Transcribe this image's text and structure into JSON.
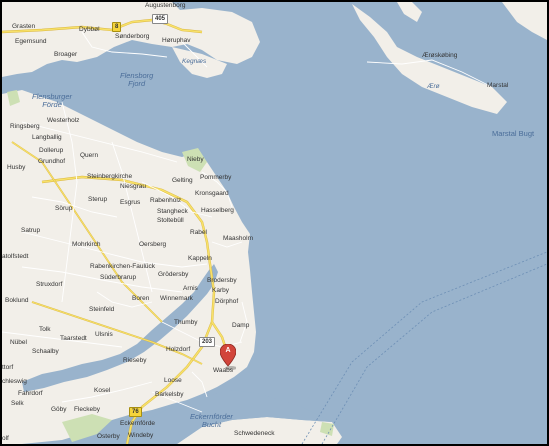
{
  "map": {
    "marker": {
      "label": "A",
      "color": "#d2453b"
    },
    "places": [
      {
        "id": "augustenborg",
        "text": "Augustenborg"
      },
      {
        "id": "grasten",
        "text": "Grasten"
      },
      {
        "id": "egernsund",
        "text": "Egernsund"
      },
      {
        "id": "dybbol",
        "text": "Dybbøl"
      },
      {
        "id": "sonderborg",
        "text": "Sønderborg"
      },
      {
        "id": "horuphav",
        "text": "Høruphav"
      },
      {
        "id": "broager",
        "text": "Broager"
      },
      {
        "id": "flensborg-fjord",
        "text": "Flensborg\nFjord",
        "kind": "water"
      },
      {
        "id": "kegnaes",
        "text": "Kegnæs",
        "kind": "island"
      },
      {
        "id": "aeroskobing",
        "text": "Ærøskøbing"
      },
      {
        "id": "aero",
        "text": "Ærø",
        "kind": "island"
      },
      {
        "id": "marstal",
        "text": "Marstal"
      },
      {
        "id": "marstal-bugt",
        "text": "Marstal Bugt",
        "kind": "water-lg"
      },
      {
        "id": "flensburger-forde",
        "text": "Flensburger\nFörde",
        "kind": "water"
      },
      {
        "id": "westerholz",
        "text": "Westerholz"
      },
      {
        "id": "ringsberg",
        "text": "Ringsberg"
      },
      {
        "id": "langballig",
        "text": "Langballig"
      },
      {
        "id": "dollerup",
        "text": "Dollerup"
      },
      {
        "id": "grundhof",
        "text": "Grundhof"
      },
      {
        "id": "husby",
        "text": "Husby"
      },
      {
        "id": "quern",
        "text": "Quern"
      },
      {
        "id": "nieby",
        "text": "Nieby"
      },
      {
        "id": "steinbergkirche",
        "text": "Steinbergkirche"
      },
      {
        "id": "gelting",
        "text": "Gelting"
      },
      {
        "id": "pommerby",
        "text": "Pommerby"
      },
      {
        "id": "niesgrau",
        "text": "Niesgrau"
      },
      {
        "id": "kronsgaard",
        "text": "Kronsgaard"
      },
      {
        "id": "sterup",
        "text": "Sterup"
      },
      {
        "id": "esgrus",
        "text": "Esgrus"
      },
      {
        "id": "rabenholz",
        "text": "Rabenholz"
      },
      {
        "id": "sorup",
        "text": "Sörup"
      },
      {
        "id": "stangheck",
        "text": "Stangheck"
      },
      {
        "id": "hasselberg",
        "text": "Hasselberg"
      },
      {
        "id": "stoltebull",
        "text": "Stoltebüll"
      },
      {
        "id": "satrup",
        "text": "Satrup"
      },
      {
        "id": "rabel",
        "text": "Rabel"
      },
      {
        "id": "maasholm",
        "text": "Maasholm"
      },
      {
        "id": "mohrkirch",
        "text": "Mohrkirch"
      },
      {
        "id": "oersberg",
        "text": "Oersberg"
      },
      {
        "id": "tolfstedt",
        "text": "atolfstedt"
      },
      {
        "id": "kappeln",
        "text": "Kappeln"
      },
      {
        "id": "rabenkirchen",
        "text": "Rabenkirchen-Faulück"
      },
      {
        "id": "suderbrarup",
        "text": "Süderbrarup"
      },
      {
        "id": "grodersby",
        "text": "Grödersby"
      },
      {
        "id": "brodersby",
        "text": "Brodersby"
      },
      {
        "id": "struxdorf",
        "text": "Struxdorf"
      },
      {
        "id": "arnis",
        "text": "Arnis"
      },
      {
        "id": "karby",
        "text": "Karby"
      },
      {
        "id": "boren",
        "text": "Boren"
      },
      {
        "id": "winnemark",
        "text": "Winnemark"
      },
      {
        "id": "dorphof",
        "text": "Dörphof"
      },
      {
        "id": "boklund",
        "text": "Boklund"
      },
      {
        "id": "steinfeld",
        "text": "Steinfeld"
      },
      {
        "id": "thumby",
        "text": "Thumby"
      },
      {
        "id": "damp",
        "text": "Damp"
      },
      {
        "id": "tolk",
        "text": "Tolk"
      },
      {
        "id": "taarstedt",
        "text": "Taarstedt"
      },
      {
        "id": "ulsnis",
        "text": "Ulsnis"
      },
      {
        "id": "nubel",
        "text": "Nübel"
      },
      {
        "id": "schaalby",
        "text": "Schaalby"
      },
      {
        "id": "holzdorf",
        "text": "Holzdorf"
      },
      {
        "id": "rieseby",
        "text": "Rieseby"
      },
      {
        "id": "waabs",
        "text": "Waabs"
      },
      {
        "id": "schleswig",
        "text": "chleswig"
      },
      {
        "id": "fahrdorf",
        "text": "Fahrdorf"
      },
      {
        "id": "kosel",
        "text": "Kosel"
      },
      {
        "id": "loose",
        "text": "Loose"
      },
      {
        "id": "barkelsby",
        "text": "Barkelsby"
      },
      {
        "id": "selk",
        "text": "Selk"
      },
      {
        "id": "goby",
        "text": "Göby"
      },
      {
        "id": "fleckeby",
        "text": "Fleckeby"
      },
      {
        "id": "eckernforder-bucht",
        "text": "Eckernförder\nBucht",
        "kind": "water"
      },
      {
        "id": "eckernforde",
        "text": "Eckernförde"
      },
      {
        "id": "schwedeneck",
        "text": "Schwedeneck"
      },
      {
        "id": "osterby",
        "text": "Osterby"
      },
      {
        "id": "windeby",
        "text": "Windeby"
      },
      {
        "id": "gottorf",
        "text": "ttorf"
      },
      {
        "id": "kolf",
        "text": "olf"
      }
    ],
    "shields": [
      {
        "id": "r8",
        "text": "8",
        "style": "yellow"
      },
      {
        "id": "r405",
        "text": "405",
        "style": "white"
      },
      {
        "id": "r203",
        "text": "203",
        "style": "white"
      },
      {
        "id": "r76",
        "text": "76",
        "style": "yellow"
      }
    ],
    "colors": {
      "water": "#99b3cc",
      "land": "#f2efe9",
      "green": "#cde0b4",
      "road_yellow": "#f7e16a",
      "road_white": "#ffffff"
    }
  }
}
